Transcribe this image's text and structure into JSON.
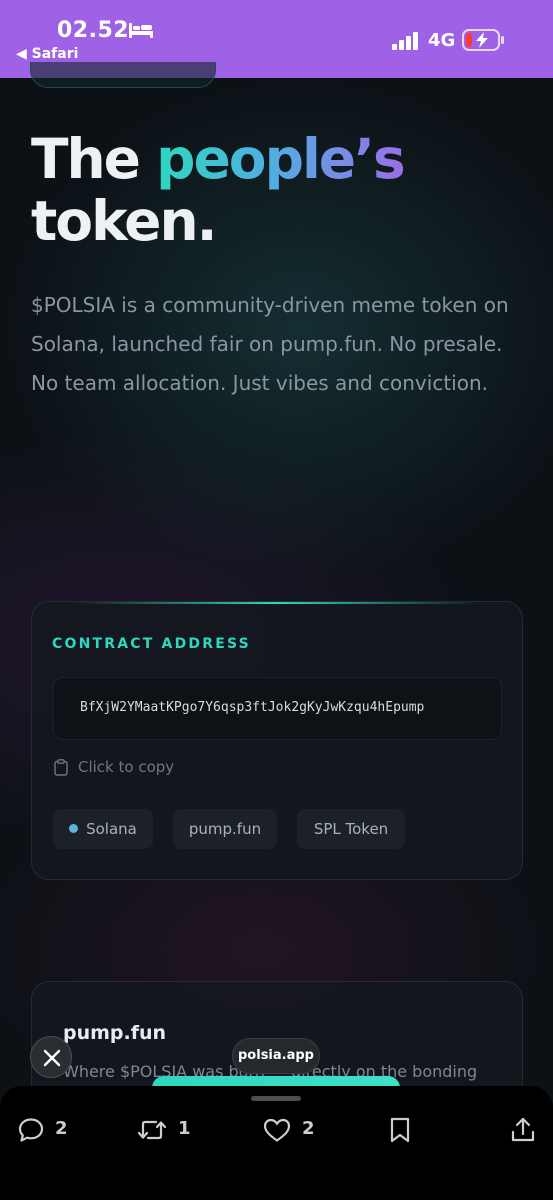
{
  "status_bar": {
    "time": "02.52",
    "back_label": "◀ Safari",
    "network": "4G",
    "bed_icon": "bed-icon",
    "signal_icon": "signal-bars-icon",
    "battery_icon": "battery-charging-icon"
  },
  "hero": {
    "title_prefix": "The ",
    "title_highlight": "people’s",
    "title_suffix": "token.",
    "description": "$POLSIA is a community-driven meme token on Solana, launched fair on pump.fun. No presale. No team allocation. Just vibes and conviction."
  },
  "contract_card": {
    "label": "CONTRACT ADDRESS",
    "address": "BfXjW2YMaatKPgo7Y6qsp3ftJok2gKyJwKzqu4hEpump",
    "copy_label": "Click to copy",
    "tags": [
      "Solana",
      "pump.fun",
      "SPL Token"
    ]
  },
  "info_card": {
    "title": "pump.fun",
    "description": "Where $POLSIA was born — directly on the bonding"
  },
  "overlay": {
    "url": "polsia.app"
  },
  "actions": {
    "replies": "2",
    "reposts": "1",
    "likes": "2"
  },
  "colors": {
    "status_bar": "#9f62e6",
    "accent": "#2fd6c0",
    "gradient_end": "#9b6ee8",
    "background": "#0c1116"
  }
}
